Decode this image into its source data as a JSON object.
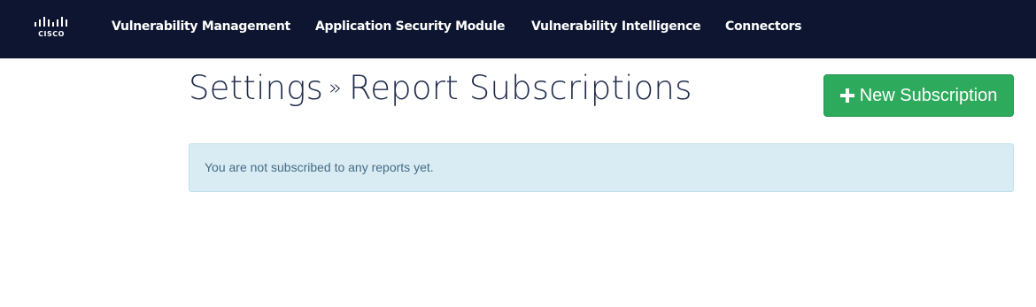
{
  "brand": {
    "logo_text": "CISCO",
    "nav_bg_color": "#0d1530"
  },
  "nav": {
    "items": [
      {
        "label": "Vulnerability Management"
      },
      {
        "label": "Application Security Module"
      },
      {
        "label": "Vulnerability Intelligence"
      },
      {
        "label": "Connectors"
      }
    ]
  },
  "header": {
    "breadcrumb_root": "Settings",
    "breadcrumb_separator": "»",
    "breadcrumb_current": "Report Subscriptions"
  },
  "actions": {
    "new_subscription_label": "New Subscription",
    "new_subscription_icon": "plus-icon",
    "button_color": "#2eaa5c"
  },
  "alert": {
    "message": "You are not subscribed to any reports yet.",
    "bg_color": "#d9ecf4"
  }
}
